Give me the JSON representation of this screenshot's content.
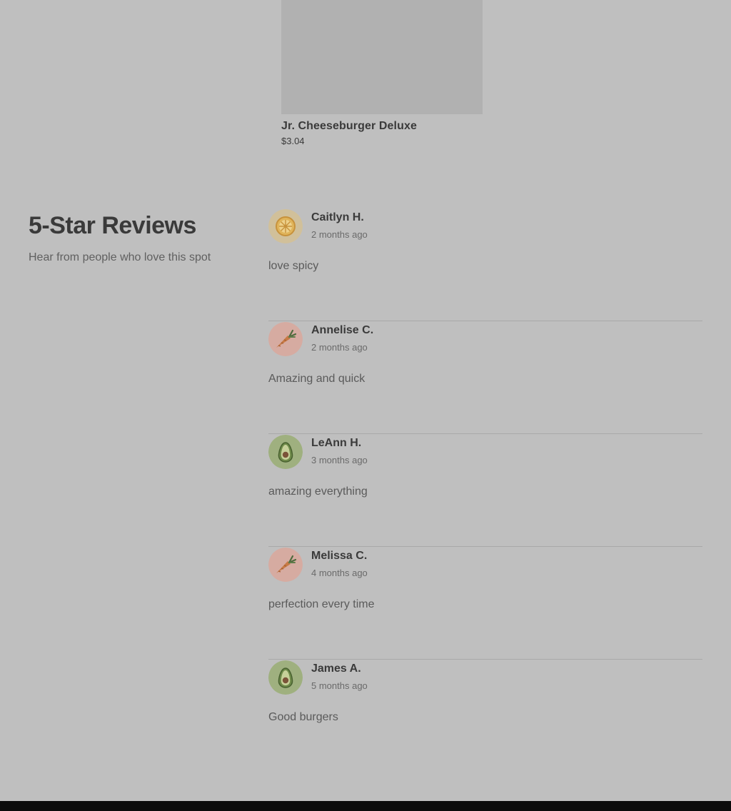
{
  "product": {
    "name": "Jr. Cheeseburger Deluxe",
    "price": "$3.04"
  },
  "reviews_section": {
    "title": "5-Star Reviews",
    "subtitle": "Hear from people who love this spot",
    "reviews": [
      {
        "name": "Caitlyn H.",
        "date": "2 months ago",
        "text": "love spicy",
        "avatar_icon": "lemon-icon"
      },
      {
        "name": "Annelise C.",
        "date": "2 months ago",
        "text": "Amazing and quick",
        "avatar_icon": "carrot-icon"
      },
      {
        "name": "LeAnn H.",
        "date": "3 months ago",
        "text": "amazing everything",
        "avatar_icon": "avocado-icon"
      },
      {
        "name": "Melissa C.",
        "date": "4 months ago",
        "text": "perfection every time",
        "avatar_icon": "carrot-icon"
      },
      {
        "name": "James A.",
        "date": "5 months ago",
        "text": "Good burgers",
        "avatar_icon": "avocado-icon"
      }
    ]
  },
  "colors": {
    "overlay_background": "#bfbfbf",
    "footer": "#0b0b0b"
  }
}
